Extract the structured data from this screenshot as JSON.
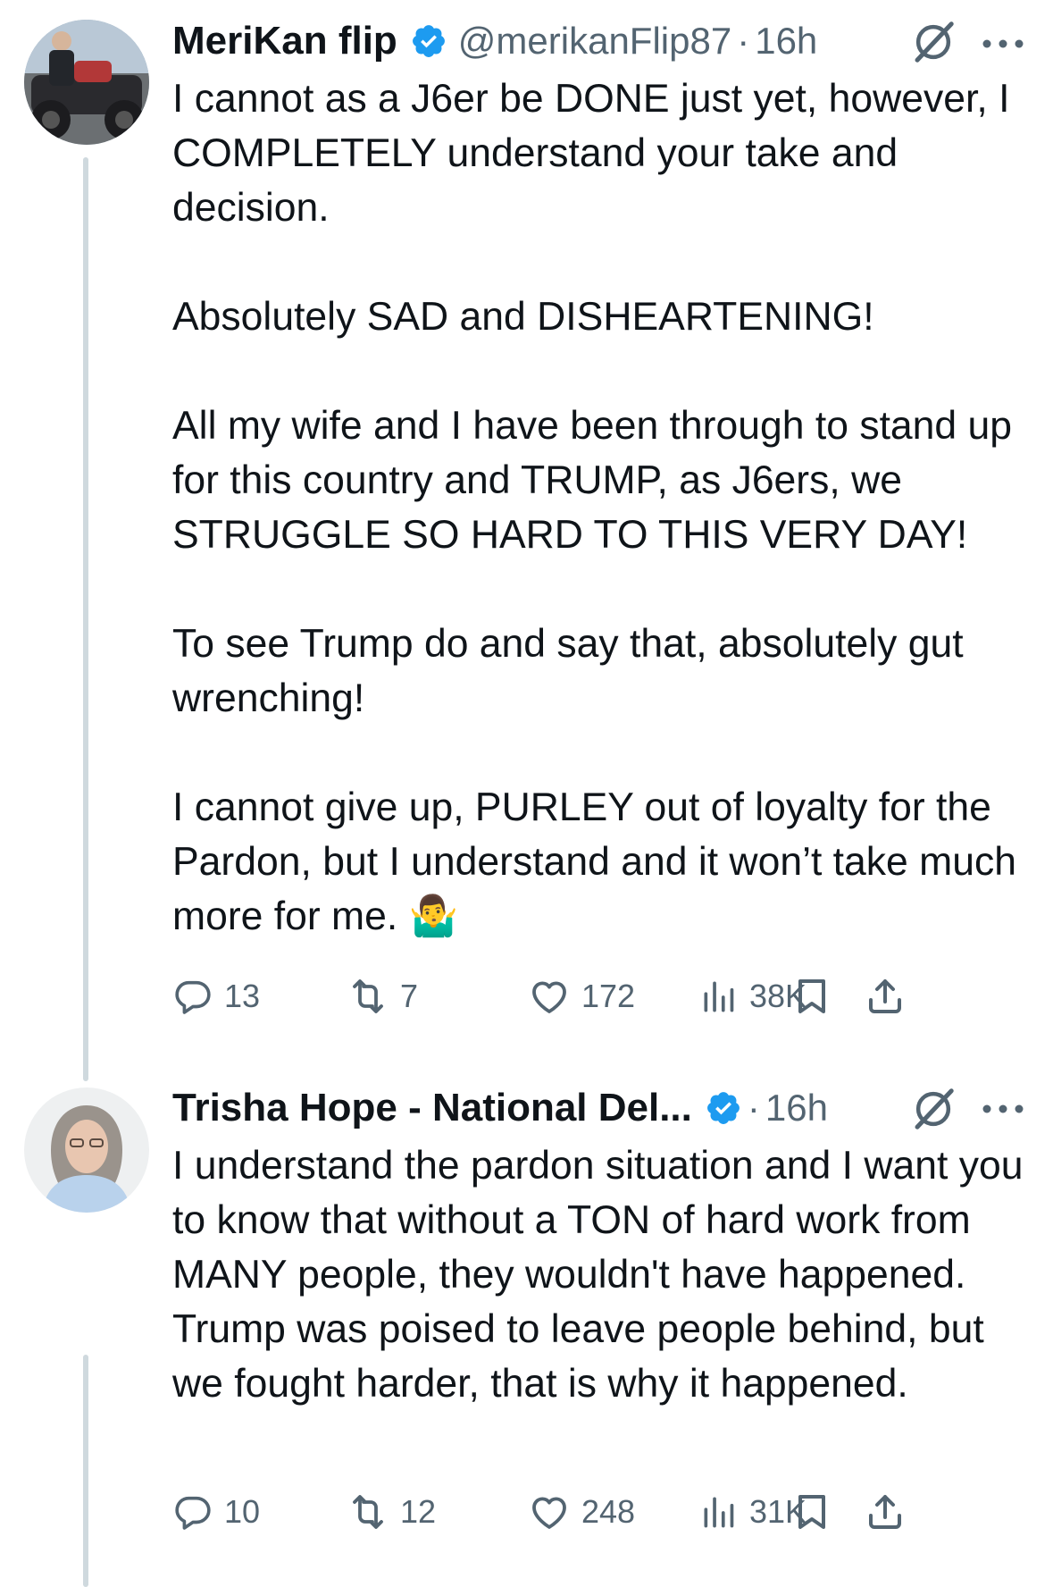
{
  "tweets": [
    {
      "author": {
        "name": "MeriKan flip",
        "handle": "@merikanFlip87",
        "separator": "·",
        "time": "16h"
      },
      "text": "I cannot as a J6er be DONE just yet, however, I COMPLETELY understand your take and decision.\n\nAbsolutely SAD and DISHEARTENING!\n\nAll my wife and I have been through to stand up for this country and TRUMP, as J6ers, we STRUGGLE SO HARD TO THIS VERY DAY!\n\nTo see Trump do and say that, absolutely gut wrenching!\n\nI cannot give up, PURLEY out of loyalty for the Pardon, but I understand and it won’t take much more for me. 🤷‍♂️",
      "stats": {
        "replies": "13",
        "reposts": "7",
        "likes": "172",
        "views": "38K"
      }
    },
    {
      "author": {
        "name": "Trisha Hope - National Del...",
        "handle": "",
        "separator": "·",
        "time": "16h"
      },
      "text": "I understand the pardon situation and I want you to know that without a TON of hard work from MANY people, they wouldn't have happened.  Trump was poised to leave people behind, but we fought harder, that is why it happened.",
      "stats": {
        "replies": "10",
        "reposts": "12",
        "likes": "248",
        "views": "31K"
      }
    }
  ],
  "colors": {
    "text": "#0f1419",
    "secondary": "#536471",
    "verified": "#1d9bf0",
    "thread_line": "#cfd9de"
  },
  "icons": [
    "reply-icon",
    "repost-icon",
    "like-icon",
    "views-icon",
    "bookmark-icon",
    "share-icon",
    "grok-icon",
    "more-icon",
    "verified-badge-icon"
  ]
}
